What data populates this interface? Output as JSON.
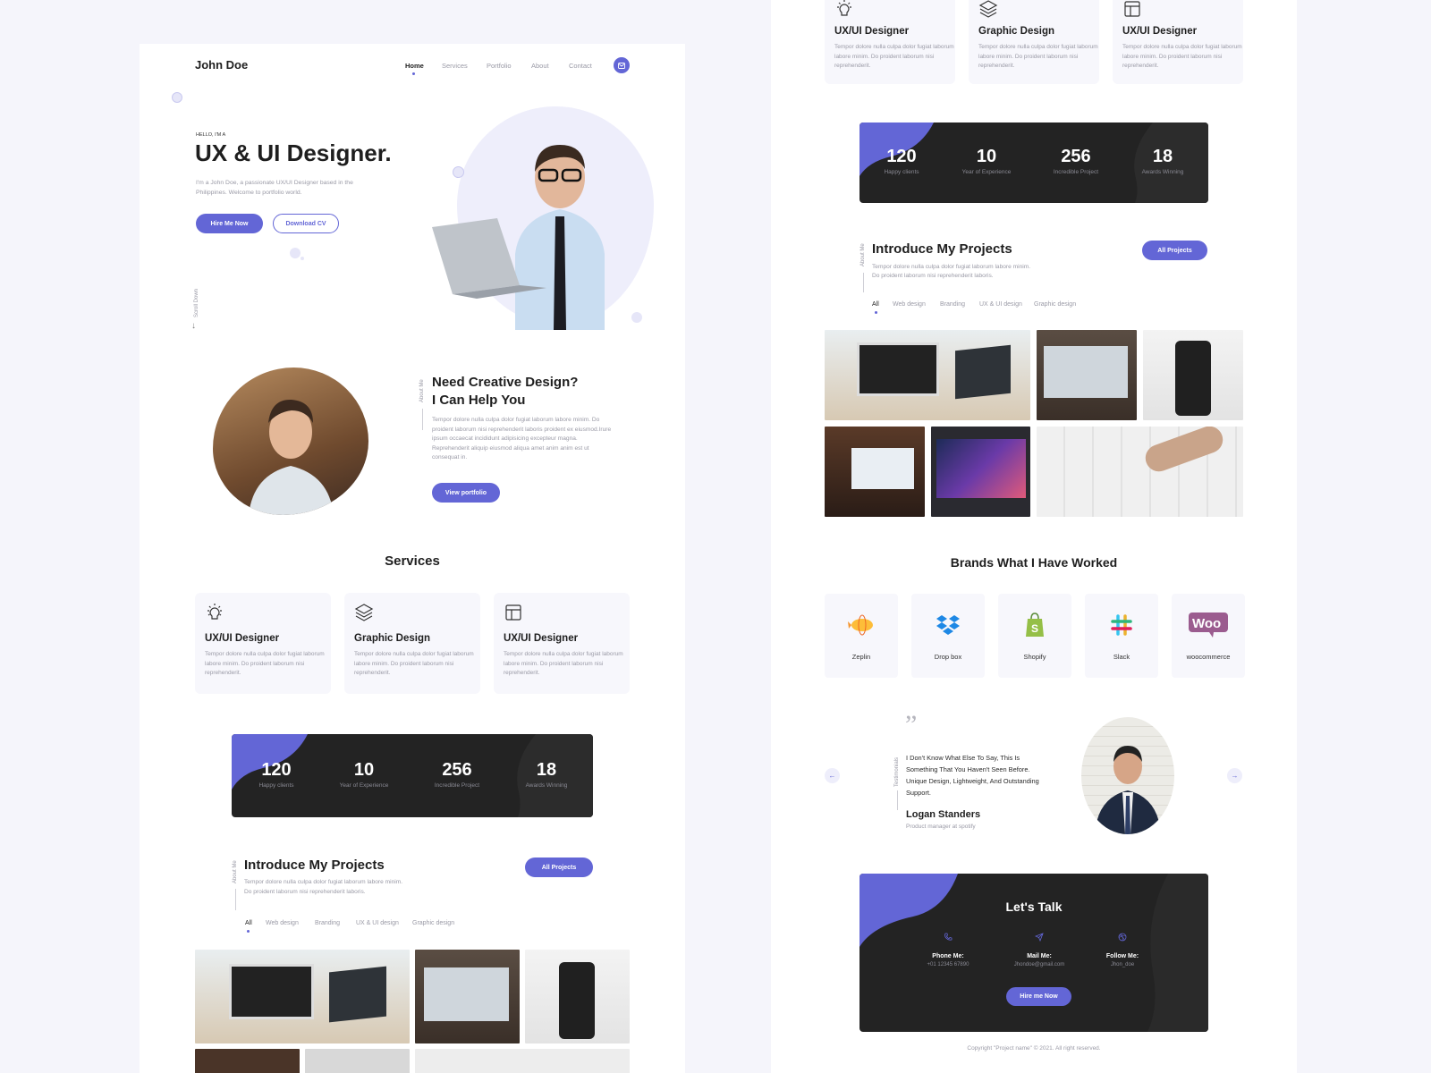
{
  "colors": {
    "accent": "#6366d6",
    "dark": "#232323",
    "page_bg": "#f5f5fb",
    "card_bg": "#f7f7fc"
  },
  "header": {
    "logo": "John Doe",
    "nav": [
      {
        "label": "Home",
        "active": true
      },
      {
        "label": "Services"
      },
      {
        "label": "Portfolio"
      },
      {
        "label": "About"
      },
      {
        "label": "Contact"
      }
    ],
    "mail_icon": "mail-icon"
  },
  "hero": {
    "eyebrow": "HELLO, I'M A",
    "title": "UX & UI Designer.",
    "description": "I'm a John Doe, a passionate UX/UI Designer based in the Philippines. Welcome to portfolio world.",
    "primary_button": "Hire Me Now",
    "secondary_button": "Download CV",
    "scroll_label": "Scroll Down"
  },
  "about": {
    "side_label": "About Me",
    "title_line1": "Need Creative Design?",
    "title_line2": "I Can Help You",
    "description": "Tempor dolore nulla culpa dolor fugiat laborum labore minim. Do proident laborum nisi reprehenderit laboris proident ex eiusmod.Irure ipsum occaecat incididunt adipisicing excepteur magna. Reprehenderit aliquip eiusmod aliqua amet anim anim est ut consequat in.",
    "button": "View portfolio"
  },
  "services": {
    "title": "Services",
    "items": [
      {
        "icon": "lightbulb-icon",
        "title": "UX/UI Designer",
        "desc": "Tempor dolore nulla culpa dolor fugiat laborum labore minim. Do proident laborum nisi reprehenderit."
      },
      {
        "icon": "layers-icon",
        "title": "Graphic Design",
        "desc": "Tempor dolore nulla culpa dolor fugiat laborum labore minim. Do proident laborum nisi reprehenderit."
      },
      {
        "icon": "layout-icon",
        "title": "UX/UI Designer",
        "desc": "Tempor dolore nulla culpa dolor fugiat laborum labore minim. Do proident laborum nisi reprehenderit."
      }
    ]
  },
  "stats": [
    {
      "value": "120",
      "label": "Happy clients"
    },
    {
      "value": "10",
      "label": "Year of Experience"
    },
    {
      "value": "256",
      "label": "Incredible Project"
    },
    {
      "value": "18",
      "label": "Awards Winning"
    }
  ],
  "projects": {
    "side_label": "About Me",
    "title": "Introduce My Projects",
    "desc_line1": "Tempor dolore nulla culpa dolor fugiat laborum labore minim.",
    "desc_line2": "Do proident laborum nisi reprehenderit laboris.",
    "button": "All Projects",
    "filters": [
      {
        "label": "All",
        "active": true
      },
      {
        "label": "Web design"
      },
      {
        "label": "Branding"
      },
      {
        "label": "UX & UI design"
      },
      {
        "label": "Graphic design"
      }
    ]
  },
  "brands": {
    "title": "Brands What I Have Worked",
    "items": [
      {
        "name": "Zeplin",
        "icon": "zeplin-logo-icon"
      },
      {
        "name": "Drop box",
        "icon": "dropbox-logo-icon"
      },
      {
        "name": "Shopify",
        "icon": "shopify-logo-icon"
      },
      {
        "name": "Slack",
        "icon": "slack-logo-icon"
      },
      {
        "name": "woocommerce",
        "icon": "woocommerce-logo-icon"
      }
    ]
  },
  "testimonial": {
    "side_label": "Testimonials",
    "quote": "I Don't Know What Else To Say, This Is Something That You Haven't Seen Before. Unique Design, Lightweight, And Outstanding Support.",
    "name": "Logan Standers",
    "role": "Product manager at spotify"
  },
  "contact": {
    "title": "Let's Talk",
    "items": [
      {
        "icon": "phone-icon",
        "label": "Phone Me:",
        "value": "+01 12345 67890"
      },
      {
        "icon": "send-icon",
        "label": "Mail Me:",
        "value": "Jhondoe@gmail.com"
      },
      {
        "icon": "dribbble-icon",
        "label": "Follow Me:",
        "value": "Jhon_doe"
      }
    ],
    "button": "Hire me Now"
  },
  "footer": {
    "copyright": "Copyright \"Project name\" © 2021. All right reserved."
  }
}
